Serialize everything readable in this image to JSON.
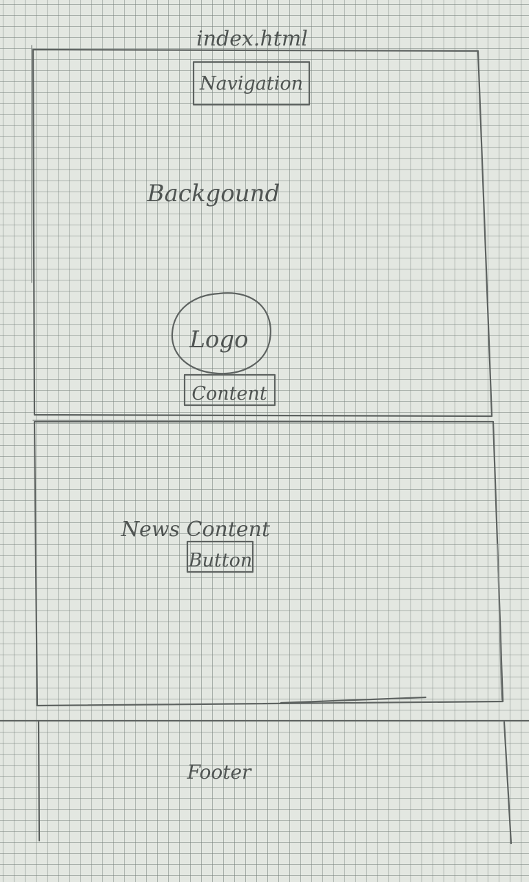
{
  "file_title": "index.html",
  "labels": {
    "navigation": "Navigation",
    "background": "Backgound",
    "logo": "Logo",
    "content": "Content",
    "news_content": "News Content",
    "button": "Button",
    "footer": "Footer"
  }
}
